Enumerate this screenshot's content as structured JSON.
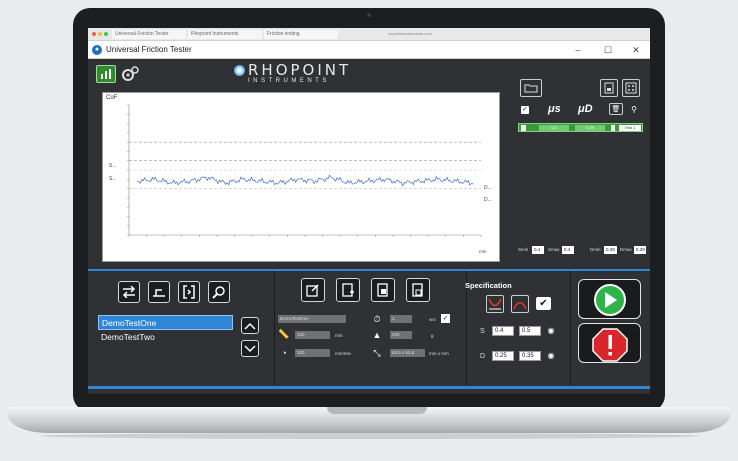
{
  "browser": {
    "tabs": [
      "Universal Friction Tester",
      "Rhopoint Instruments",
      "Friction testing"
    ],
    "url": "rhopointinstruments.com"
  },
  "window": {
    "title": "Universal Friction Tester",
    "minimize": "–",
    "maximize": "☐",
    "close": "✕"
  },
  "logo": {
    "line1": "RHOPOINT",
    "line2": "INSTRUMENTS"
  },
  "right_panel": {
    "mu_s": "μs",
    "mu_d": "μD",
    "green_row": {
      "a": "0.4",
      "b": "0.29",
      "c": "Test 1"
    },
    "summary": [
      {
        "label": "Smin",
        "val": "0.4"
      },
      {
        "label": "Smax",
        "val": "0.4"
      },
      {
        "label": "Dmin",
        "val": "0.29"
      },
      {
        "label": "Dmax",
        "val": "0.29"
      }
    ]
  },
  "chart_data": {
    "type": "line",
    "ylabel": "CoF",
    "xlabel": "mm",
    "y_axis_labels": [
      "S...",
      "S..."
    ],
    "right_labels": [
      "D...",
      "D..."
    ],
    "series": [
      {
        "values": [
          0.29,
          0.3,
          0.28,
          0.29,
          0.31,
          0.28,
          0.3,
          0.29,
          0.28,
          0.3,
          0.29,
          0.31,
          0.28,
          0.29,
          0.3,
          0.28,
          0.29,
          0.3,
          0.29,
          0.28
        ]
      }
    ],
    "limits": {
      "s_lower": 0.4,
      "s_upper": 0.5,
      "d_lower": 0.25,
      "d_upper": 0.35
    }
  },
  "tests": {
    "items": [
      "DemoTestOne",
      "DemoTestTwo"
    ],
    "selected": "DemoTestOne"
  },
  "form": {
    "name": "DemoTestOne",
    "distance": "150",
    "distance_unit": "mm",
    "speed": "300",
    "speed_unit": "mm/min",
    "time": "1",
    "time_unit": "sec",
    "weight": "200",
    "weight_unit": "g",
    "sled": "63.5 x 63.5",
    "sled_unit": "mm x mm"
  },
  "specification": {
    "title": "Specification",
    "s_min": "0.4",
    "s_max": "0.5",
    "d_min": "0.25",
    "d_max": "0.35",
    "s_label": "S",
    "d_label": "D"
  },
  "colors": {
    "accent": "#2f86d6",
    "app_bg": "#2f3134",
    "go": "#2db34a",
    "stop": "#d9262a"
  }
}
